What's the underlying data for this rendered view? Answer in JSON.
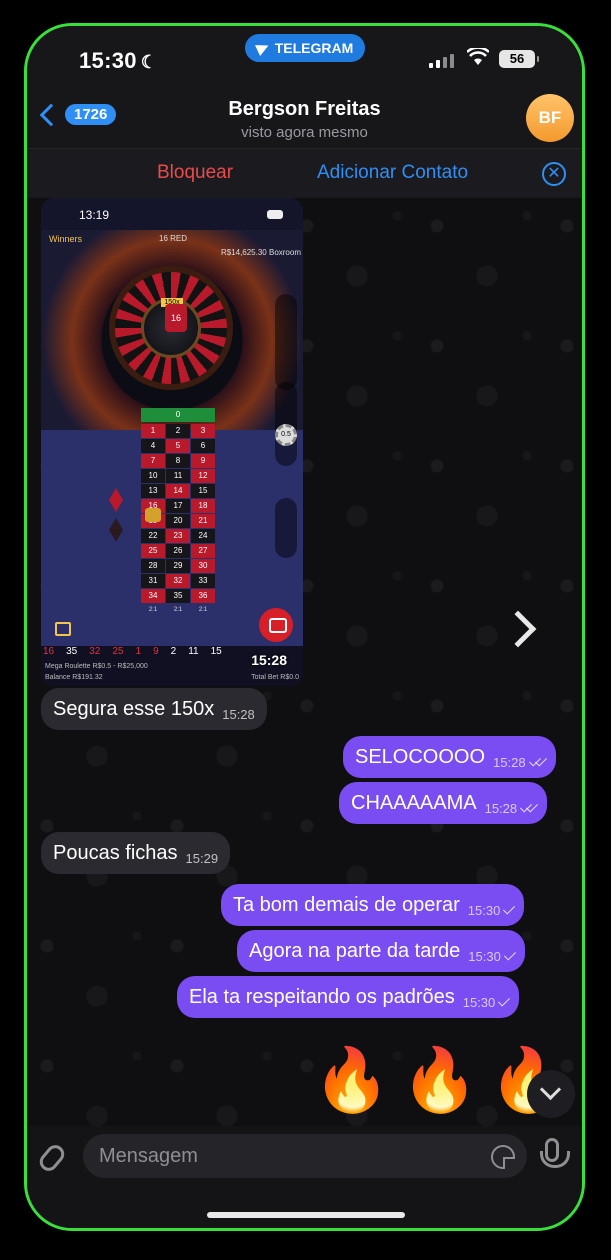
{
  "status_bar": {
    "time": "15:30",
    "app_pill": "TELEGRAM",
    "battery": "56"
  },
  "header": {
    "back_count": "1726",
    "name": "Bergson Freitas",
    "last_seen": "visto agora mesmo",
    "avatar_initials": "BF"
  },
  "action_bar": {
    "block": "Bloquear",
    "add_contact": "Adicionar Contato"
  },
  "media": {
    "phone_time": "13:19",
    "winners": "Winners",
    "result_label": "16 RED",
    "balance_top": "R$14,625.30 Boxroom",
    "multiplier": "150x",
    "wheel_number": "16",
    "chip_value": "0.5",
    "zero": "0",
    "board": [
      [
        "1",
        "2",
        "3"
      ],
      [
        "4",
        "5",
        "6"
      ],
      [
        "7",
        "8",
        "9"
      ],
      [
        "10",
        "11",
        "12"
      ],
      [
        "13",
        "14",
        "15"
      ],
      [
        "16",
        "17",
        "18"
      ],
      [
        "19",
        "20",
        "21"
      ],
      [
        "22",
        "23",
        "24"
      ],
      [
        "25",
        "26",
        "27"
      ],
      [
        "28",
        "29",
        "30"
      ],
      [
        "31",
        "32",
        "33"
      ],
      [
        "34",
        "35",
        "36"
      ]
    ],
    "col_foot": [
      "2:1",
      "2:1",
      "2:1"
    ],
    "history": [
      "16",
      "35",
      "32",
      "25",
      "1",
      "9",
      "2",
      "11",
      "15"
    ],
    "game_name": "Mega Roulette",
    "limits": "R$0.5 - R$25,000",
    "balance": "Balance R$191.32",
    "total_bet": "Total Bet R$0.0",
    "timestamp": "15:28"
  },
  "messages": [
    {
      "dir": "in",
      "text": "Segura esse 150x",
      "time": "15:28"
    },
    {
      "dir": "out",
      "text": "SELOCOOOO",
      "time": "15:28",
      "read": true
    },
    {
      "dir": "out",
      "text": "CHAAAAAMA",
      "time": "15:28",
      "read": true
    },
    {
      "dir": "in",
      "text": "Poucas fichas",
      "time": "15:29"
    },
    {
      "dir": "out",
      "text": "Ta bom demais de operar",
      "time": "15:30",
      "read": false
    },
    {
      "dir": "out",
      "text": "Agora na parte da tarde",
      "time": "15:30",
      "read": false
    },
    {
      "dir": "out",
      "text": "Ela ta respeitando os padrões",
      "time": "15:30",
      "read": false
    }
  ],
  "fire_emoji": "🔥",
  "composer": {
    "placeholder": "Mensagem"
  },
  "colors": {
    "frame": "#39e03a",
    "accent": "#2f8ff5",
    "danger": "#e94b4b",
    "outgoing": "#7a4df2",
    "incoming": "#2a2a30"
  }
}
